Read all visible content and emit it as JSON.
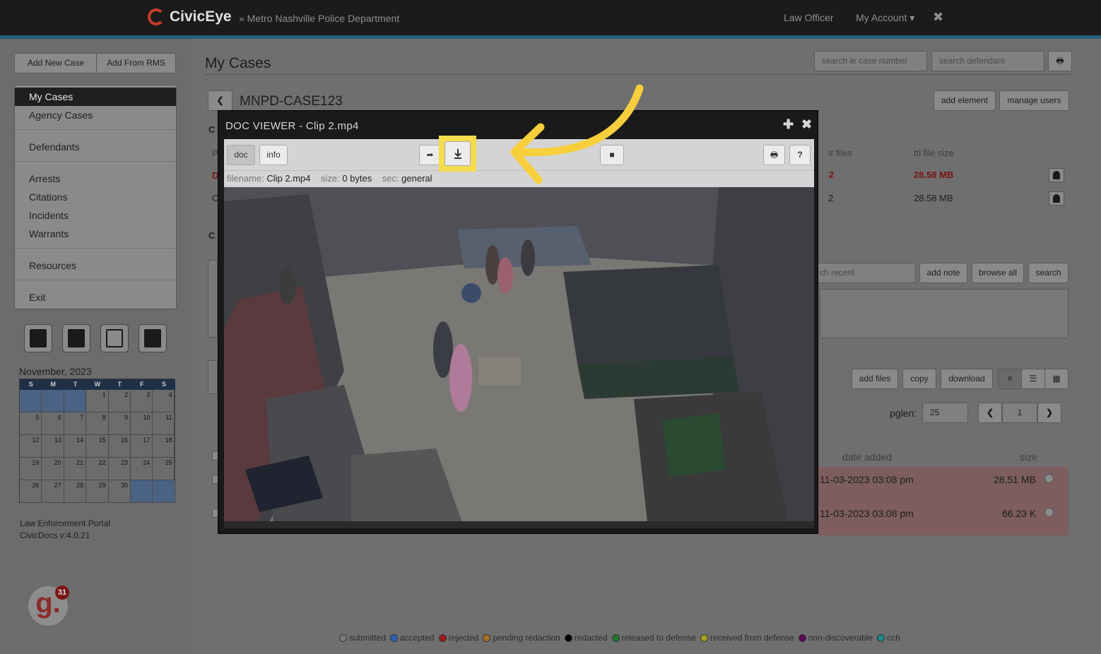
{
  "topbar": {
    "brand": "CivicEye",
    "department": "» Metro Nashville Police Department",
    "user_role": "Law Officer",
    "account_menu": "My Account ▾",
    "close_glyph": "✖"
  },
  "sidebar": {
    "add_new_case": "Add New Case",
    "add_from_rms": "Add From RMS",
    "menu": [
      "My Cases",
      "Agency Cases",
      "Defendants",
      "Arrests",
      "Citations",
      "Incidents",
      "Warrants",
      "Resources",
      "Exit"
    ],
    "active_item": "My Cases",
    "tool_icons": [
      "calculator-icon",
      "calendar-icon",
      "map-icon",
      "book-icon"
    ],
    "calendar": {
      "month": "November, 2023",
      "weekdays": [
        "S",
        "M",
        "T",
        "W",
        "T",
        "F",
        "S"
      ],
      "weeks": [
        [
          "",
          "",
          "",
          "1",
          "2",
          "3",
          "4"
        ],
        [
          "5",
          "6",
          "7",
          "8",
          "9",
          "10",
          "11"
        ],
        [
          "12",
          "13",
          "14",
          "15",
          "16",
          "17",
          "18"
        ],
        [
          "19",
          "20",
          "21",
          "22",
          "23",
          "24",
          "25"
        ],
        [
          "26",
          "27",
          "28",
          "29",
          "30",
          "",
          ""
        ]
      ]
    },
    "portal_line1": "Law Enforcement Portal",
    "portal_line2": "CivicDocs v:4.0.21",
    "badge_letter": "g.",
    "badge_count": "31"
  },
  "main": {
    "title": "My Cases",
    "search_case_placeholder": "search le case number",
    "search_defendant_placeholder": "search defendant",
    "case_id": "MNPD-CASE123",
    "add_element": "add element",
    "manage_users": "manage users",
    "cut_letters": {
      "c1": "C",
      "p": "P",
      "d": "D",
      "c2": "C",
      "c3": "C"
    },
    "files_header": "# files",
    "size_header": "ttl file size",
    "rows": [
      {
        "files": "2",
        "size": "28.58 MB"
      },
      {
        "files": "2",
        "size": "28.58 MB"
      }
    ],
    "search_recent_placeholder": "rch recent",
    "add_note": "add note",
    "browse_all": "browse all",
    "search": "search",
    "add_files": "add files",
    "copy": "copy",
    "download": "download",
    "pglen_label": "pglen:",
    "pglen_value": "25",
    "page_number": "1",
    "date_added_header": "date added",
    "size_col_header": "size",
    "file_rows": [
      {
        "date": "11-03-2023 03:08 pm",
        "size": "28.51 MB"
      },
      {
        "date": "11-03-2023 03:08 pm",
        "size": "66.23 K"
      }
    ]
  },
  "legend": [
    {
      "label": "submitted",
      "color": "#7a7a7a"
    },
    {
      "label": "accepted",
      "color": "#2f5fb3"
    },
    {
      "label": "rejected",
      "color": "#a01a1a"
    },
    {
      "label": "pending redaction",
      "color": "#a87020"
    },
    {
      "label": "redacted",
      "color": "#000000"
    },
    {
      "label": "released to defense",
      "color": "#1f7a2a"
    },
    {
      "label": "received from defense",
      "color": "#a8a020"
    },
    {
      "label": "non-discoverable",
      "color": "#5a0a5a"
    },
    {
      "label": "cch",
      "color": "#1a8a8a"
    }
  ],
  "viewer": {
    "title": "DOC VIEWER - Clip 2.mp4",
    "tab_doc": "doc",
    "tab_info": "info",
    "help": "?",
    "filename_label": "filename:",
    "filename": "Clip 2.mp4",
    "size_label": "size:",
    "size": "0 bytes",
    "sec_label": "sec:",
    "sec": "general"
  },
  "colors": {
    "highlight": "#f5dd4e",
    "arrow": "#f7cf3c",
    "topbar": "#1b1b1b",
    "accent": "#245f80"
  }
}
